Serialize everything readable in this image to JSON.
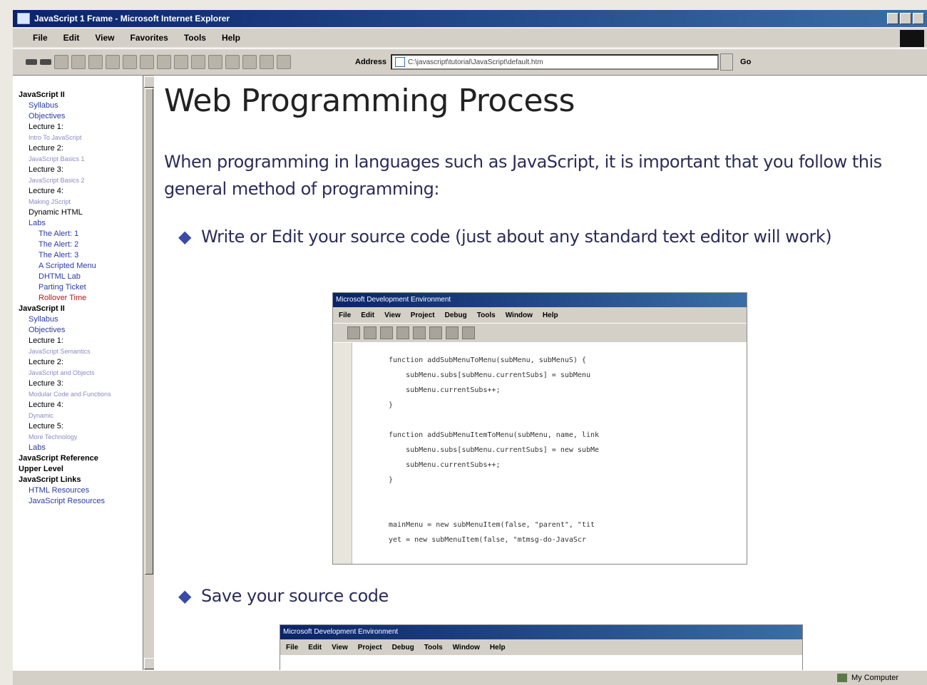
{
  "window": {
    "title": "JavaScript 1 Frame - Microsoft Internet Explorer"
  },
  "menu": [
    "File",
    "Edit",
    "View",
    "Favorites",
    "Tools",
    "Help"
  ],
  "address": {
    "label": "Address",
    "url": "C:\\javascript\\tutorial\\JavaScript\\default.htm",
    "go_label": "Go"
  },
  "sidebar": {
    "items": [
      {
        "label": "JavaScript II",
        "level": "lvl0"
      },
      {
        "label": "Syllabus",
        "level": "lvl1"
      },
      {
        "label": "Objectives",
        "level": "lvl1"
      },
      {
        "label": "Lecture 1:",
        "level": "lvl1b"
      },
      {
        "label": "Intro To JavaScript",
        "level": "sub"
      },
      {
        "label": "Lecture 2:",
        "level": "lvl1b"
      },
      {
        "label": "JavaScript Basics 1",
        "level": "sub"
      },
      {
        "label": "Lecture 3:",
        "level": "lvl1b"
      },
      {
        "label": "JavaScript Basics 2",
        "level": "sub"
      },
      {
        "label": "Lecture 4:",
        "level": "lvl1b"
      },
      {
        "label": "Making JScript",
        "level": "sub"
      },
      {
        "label": "Dynamic HTML",
        "level": "lvl1b"
      },
      {
        "label": "Labs",
        "level": "lvl1"
      },
      {
        "label": "The Alert: 1",
        "level": "lvl2"
      },
      {
        "label": "The Alert: 2",
        "level": "lvl2"
      },
      {
        "label": "The Alert: 3",
        "level": "lvl2"
      },
      {
        "label": "A Scripted Menu",
        "level": "lvl2"
      },
      {
        "label": "DHTML Lab",
        "level": "lvl2"
      },
      {
        "label": "Parting Ticket",
        "level": "lvl2"
      },
      {
        "label": "Rollover Time",
        "level": "red"
      },
      {
        "label": "JavaScript II",
        "level": "lvl0"
      },
      {
        "label": "Syllabus",
        "level": "lvl1"
      },
      {
        "label": "Objectives",
        "level": "lvl1"
      },
      {
        "label": "Lecture 1:",
        "level": "lvl1b"
      },
      {
        "label": "JavaScript Semantics",
        "level": "sub"
      },
      {
        "label": "Lecture 2:",
        "level": "lvl1b"
      },
      {
        "label": "JavaScript and Objects",
        "level": "sub"
      },
      {
        "label": "Lecture 3:",
        "level": "lvl1b"
      },
      {
        "label": "Modular Code and Functions",
        "level": "sub"
      },
      {
        "label": "Lecture 4:",
        "level": "lvl1b"
      },
      {
        "label": "Dynamic",
        "level": "sub"
      },
      {
        "label": "Lecture 5:",
        "level": "lvl1b"
      },
      {
        "label": "More Technology",
        "level": "sub"
      },
      {
        "label": "Labs",
        "level": "lvl1"
      },
      {
        "label": "JavaScript Reference",
        "level": "lvl0"
      },
      {
        "label": "Upper Level",
        "level": "lvl0"
      },
      {
        "label": "JavaScript Links",
        "level": "lvl0"
      },
      {
        "label": "HTML Resources",
        "level": "lvl1"
      },
      {
        "label": "JavaScript Resources",
        "level": "lvl1"
      }
    ]
  },
  "content": {
    "title": "Web Programming Process",
    "intro": "When programming in languages such as JavaScript, it is important that you follow this general method of programming:",
    "bullet1": "Write or Edit your source code (just about any standard text editor will work)",
    "bullet2": "Save your source code"
  },
  "ide": {
    "title": "Microsoft Development Environment",
    "menu": [
      "File",
      "Edit",
      "View",
      "Project",
      "Debug",
      "Tools",
      "Window",
      "Help"
    ],
    "code": "function addSubMenuToMenu(subMenu, subMenuS) {\n    subMenu.subs[subMenu.currentSubs] = subMenu\n    subMenu.currentSubs++;\n}\n\nfunction addSubMenuItemToMenu(subMenu, name, link\n    subMenu.subs[subMenu.currentSubs] = new subMe\n    subMenu.currentSubs++;\n}\n\n\nmainMenu = new subMenuItem(false, \"parent\", \"tit\nyet = new subMenuItem(false, \"mtmsg-do-JavaScr"
  },
  "status": {
    "zone": "My Computer"
  }
}
